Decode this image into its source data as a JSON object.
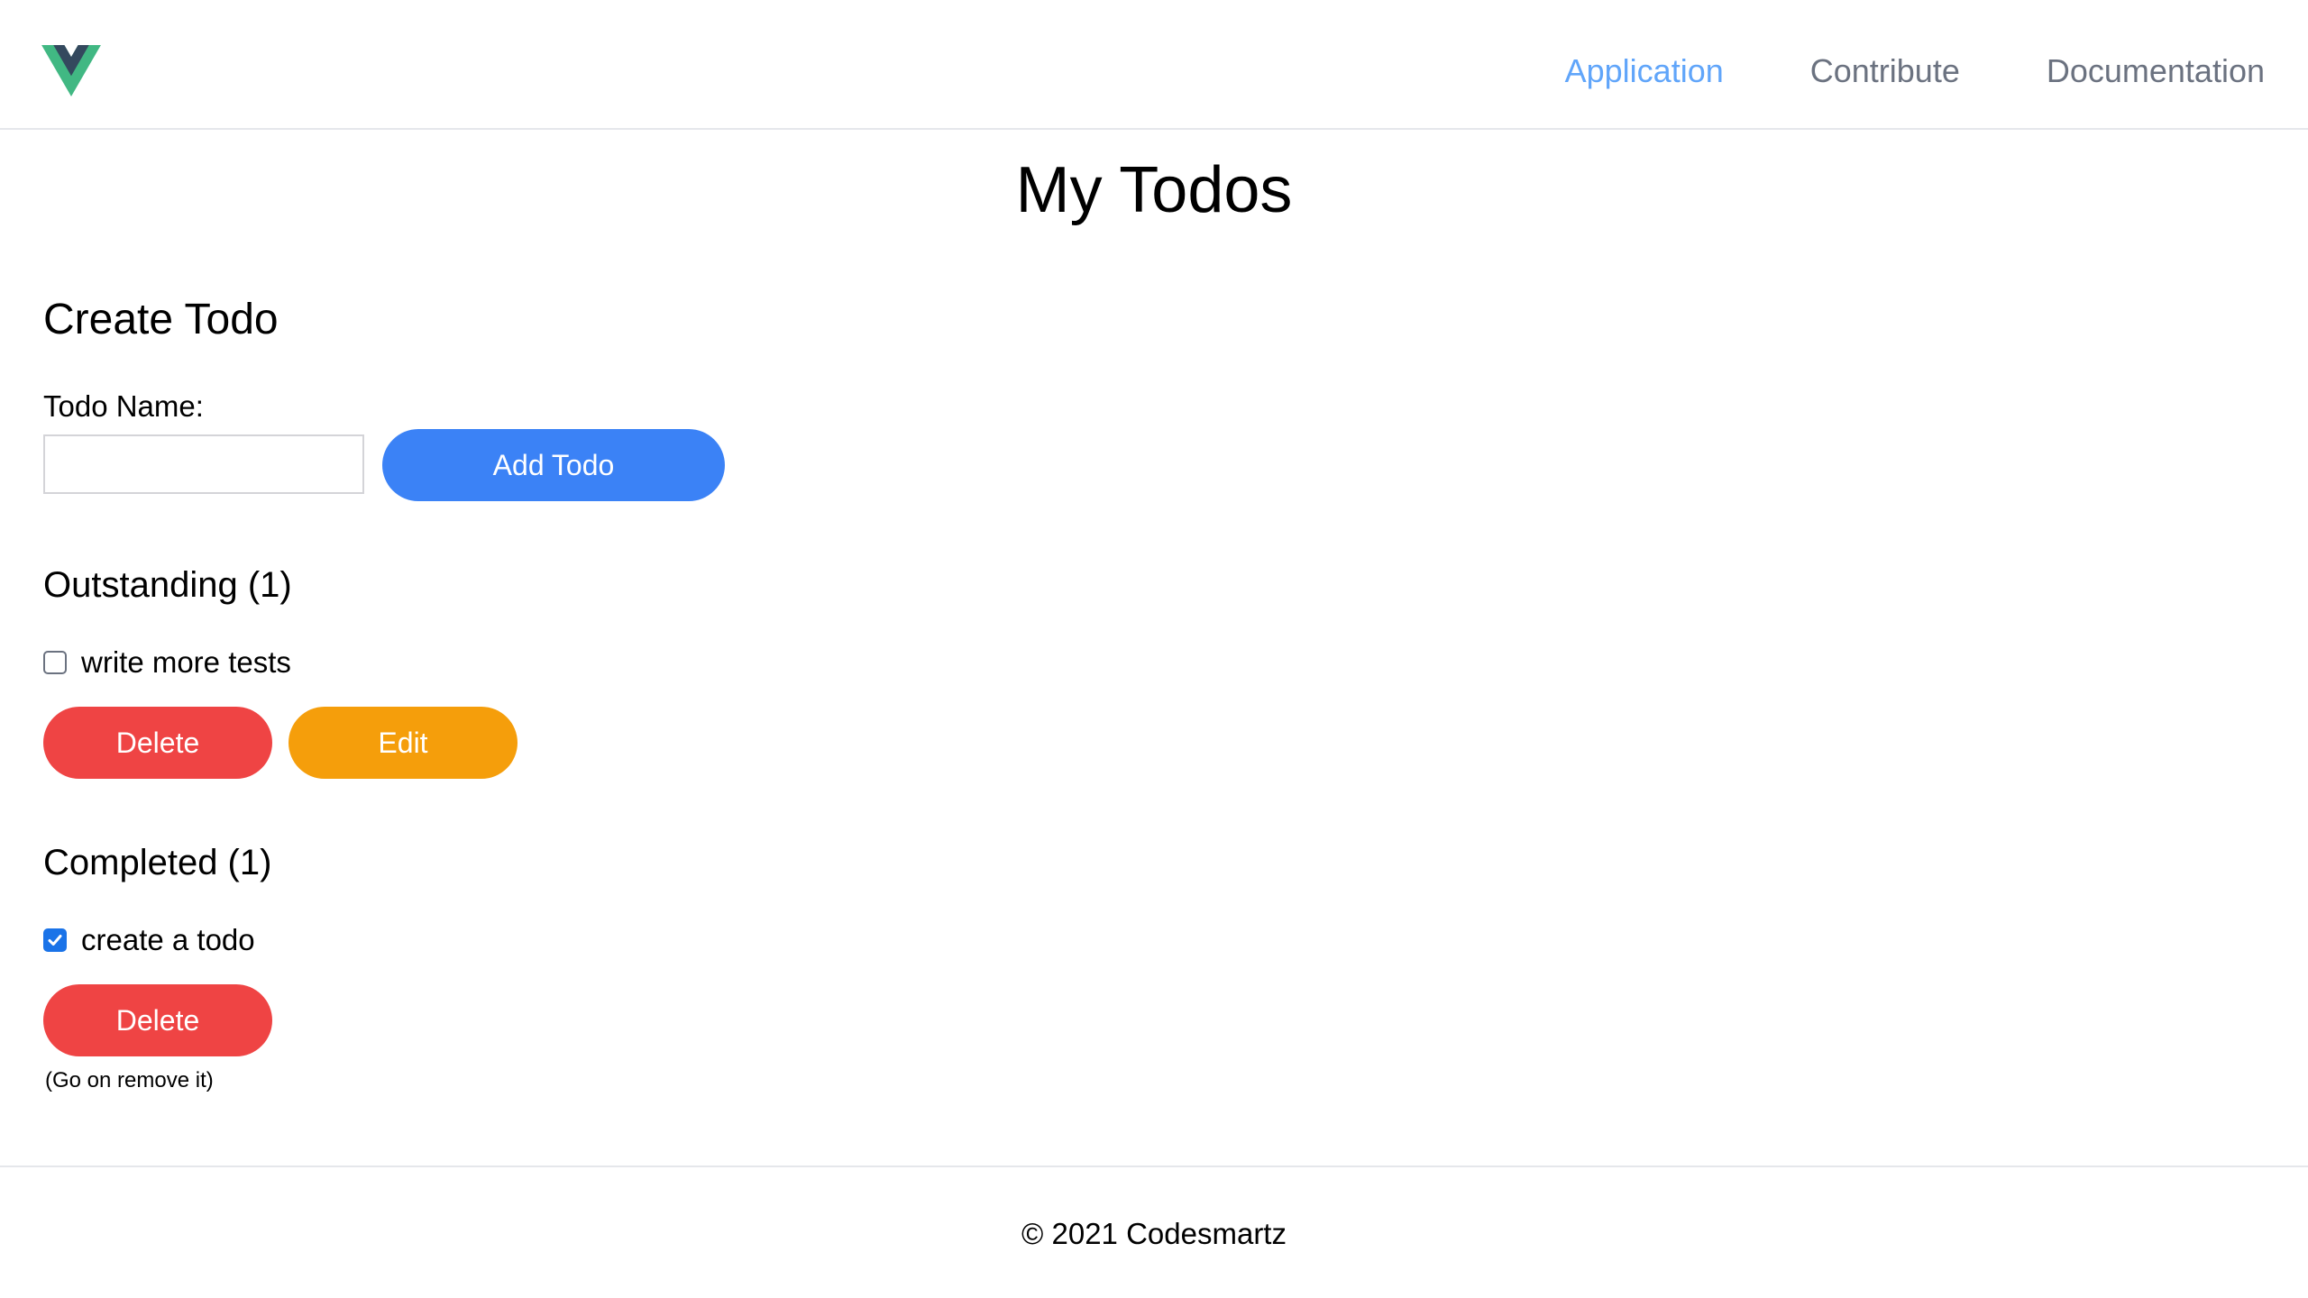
{
  "header": {
    "logo_icon": "vue-logo-icon",
    "nav": [
      {
        "label": "Application",
        "active": true
      },
      {
        "label": "Contribute",
        "active": false
      },
      {
        "label": "Documentation",
        "active": false
      }
    ]
  },
  "main": {
    "title": "My Todos",
    "create": {
      "heading": "Create Todo",
      "label": "Todo Name:",
      "input_value": "",
      "add_button": "Add Todo"
    },
    "outstanding": {
      "heading": "Outstanding (1)",
      "items": [
        {
          "text": "write more tests",
          "checked": false,
          "delete_label": "Delete",
          "edit_label": "Edit"
        }
      ]
    },
    "completed": {
      "heading": "Completed (1)",
      "items": [
        {
          "text": "create a todo",
          "checked": true,
          "delete_label": "Delete"
        }
      ],
      "hint": "(Go on remove it)"
    }
  },
  "footer": {
    "copyright": "© 2021 Codesmartz"
  },
  "colors": {
    "nav_active": "#60a5fa",
    "nav_inactive": "#6b7280",
    "add_button": "#3b82f6",
    "delete_button": "#ef4444",
    "edit_button": "#f59e0b"
  }
}
